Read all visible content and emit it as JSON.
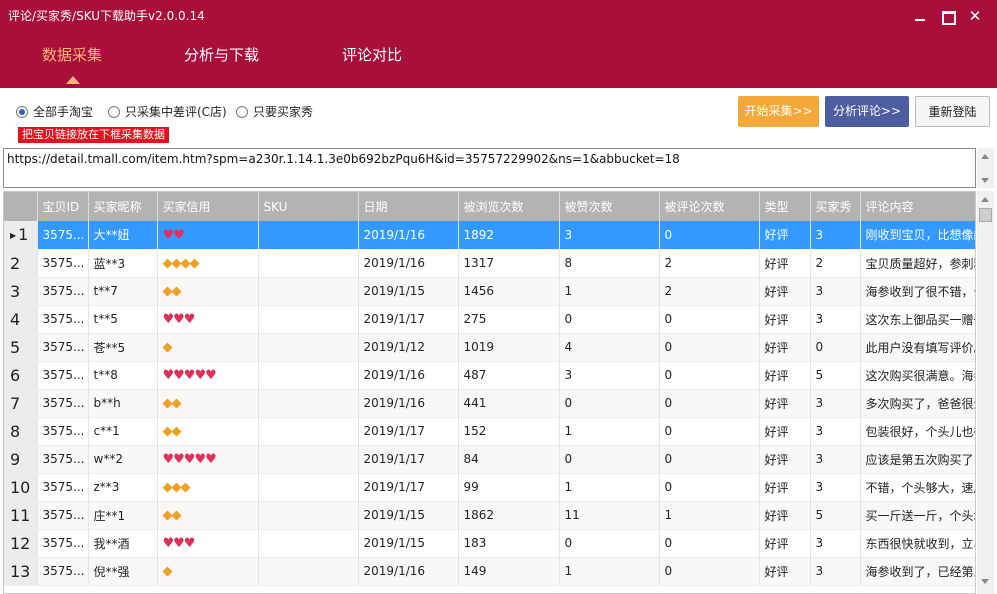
{
  "window": {
    "title": "评论/买家秀/SKU下载助手v2.0.0.14"
  },
  "nav": [
    {
      "label": "数据采集",
      "active": true
    },
    {
      "label": "分析与下载"
    },
    {
      "label": "评论对比"
    }
  ],
  "options": [
    {
      "label": "全部手淘宝",
      "checked": true
    },
    {
      "label": "只采集中差评(C店)"
    },
    {
      "label": "只要买家秀"
    }
  ],
  "hint": "把宝贝链接放在下框采集数据",
  "buttons": {
    "start": "开始采集>>",
    "analyze": "分析评论>>",
    "relogin": "重新登陆"
  },
  "url_input": {
    "value": "https://detail.tmall.com/item.htm?spm=a230r.1.14.1.3e0b692bzPqu6H&id=35757229902&ns=1&abbucket=18"
  },
  "table": {
    "columns": [
      "宝贝ID",
      "买家昵称",
      "买家信用",
      "SKU",
      "日期",
      "被浏览次数",
      "被赞次数",
      "被评论次数",
      "类型",
      "买家秀",
      "评论内容"
    ],
    "rows": [
      {
        "no": "1",
        "id": "3575...",
        "nick": "大**妞",
        "credit": "heart",
        "credit_count": 2,
        "sku": "",
        "date": "2019/1/16",
        "views": "1892",
        "likes": "3",
        "comments": "0",
        "type": "好评",
        "show": "3",
        "content": "刚收到宝贝，比想像的"
      },
      {
        "no": "2",
        "id": "3575...",
        "nick": "蓝**3",
        "credit": "diamond",
        "credit_count": 4,
        "sku": "",
        "date": "2019/1/16",
        "views": "1317",
        "likes": "8",
        "comments": "2",
        "type": "好评",
        "show": "2",
        "content": "宝贝质量超好，参刺粗"
      },
      {
        "no": "3",
        "id": "3575...",
        "nick": "t**7",
        "credit": "diamond",
        "credit_count": 2,
        "sku": "",
        "date": "2019/1/15",
        "views": "1456",
        "likes": "1",
        "comments": "2",
        "type": "好评",
        "show": "3",
        "content": "海参收到了很不错，个"
      },
      {
        "no": "4",
        "id": "3575...",
        "nick": "t**5",
        "credit": "heart",
        "credit_count": 3,
        "sku": "",
        "date": "2019/1/17",
        "views": "275",
        "likes": "0",
        "comments": "0",
        "type": "好评",
        "show": "3",
        "content": "这次东上御品买一赠一"
      },
      {
        "no": "5",
        "id": "3575...",
        "nick": "苍**5",
        "credit": "diamond",
        "credit_count": 1,
        "sku": "",
        "date": "2019/1/12",
        "views": "1019",
        "likes": "4",
        "comments": "0",
        "type": "好评",
        "show": "0",
        "content": "此用户没有填写评价。"
      },
      {
        "no": "6",
        "id": "3575...",
        "nick": "t**8",
        "credit": "heart",
        "credit_count": 5,
        "sku": "",
        "date": "2019/1/16",
        "views": "487",
        "likes": "3",
        "comments": "0",
        "type": "好评",
        "show": "5",
        "content": "这次购买很满意。海参"
      },
      {
        "no": "7",
        "id": "3575...",
        "nick": "b**h",
        "credit": "diamond",
        "credit_count": 2,
        "sku": "",
        "date": "2019/1/16",
        "views": "441",
        "likes": "0",
        "comments": "0",
        "type": "好评",
        "show": "3",
        "content": "多次购买了，爸爸很满"
      },
      {
        "no": "8",
        "id": "3575...",
        "nick": "c**1",
        "credit": "diamond",
        "credit_count": 2,
        "sku": "",
        "date": "2019/1/17",
        "views": "152",
        "likes": "1",
        "comments": "0",
        "type": "好评",
        "show": "3",
        "content": "包装很好，个头儿也很"
      },
      {
        "no": "9",
        "id": "3575...",
        "nick": "w**2",
        "credit": "heart",
        "credit_count": 5,
        "sku": "",
        "date": "2019/1/17",
        "views": "84",
        "likes": "0",
        "comments": "0",
        "type": "好评",
        "show": "3",
        "content": "应该是第五次购买了，"
      },
      {
        "no": "10",
        "id": "3575...",
        "nick": "z**3",
        "credit": "diamond",
        "credit_count": 3,
        "sku": "",
        "date": "2019/1/17",
        "views": "99",
        "likes": "1",
        "comments": "0",
        "type": "好评",
        "show": "3",
        "content": "不错，个头够大，速度"
      },
      {
        "no": "11",
        "id": "3575...",
        "nick": "庄**1",
        "credit": "diamond",
        "credit_count": 2,
        "sku": "",
        "date": "2019/1/15",
        "views": "1862",
        "likes": "11",
        "comments": "1",
        "type": "好评",
        "show": "5",
        "content": "买一斤送一斤，个头均"
      },
      {
        "no": "12",
        "id": "3575...",
        "nick": "我**酒",
        "credit": "heart",
        "credit_count": 3,
        "sku": "",
        "date": "2019/1/15",
        "views": "183",
        "likes": "0",
        "comments": "0",
        "type": "好评",
        "show": "3",
        "content": "东西很快就收到，立马"
      },
      {
        "no": "13",
        "id": "3575...",
        "nick": "倪**强",
        "credit": "diamond",
        "credit_count": 1,
        "sku": "",
        "date": "2019/1/16",
        "views": "149",
        "likes": "1",
        "comments": "0",
        "type": "好评",
        "show": "3",
        "content": "海参收到了，已经第三"
      }
    ]
  },
  "colors": {
    "brand": "#a8103a",
    "active_tab": "#ffb57a",
    "start_button": "#f3a839",
    "analyze_button": "#4d5ea0",
    "selection": "#3399ff",
    "hint_bg": "#e0141e"
  }
}
